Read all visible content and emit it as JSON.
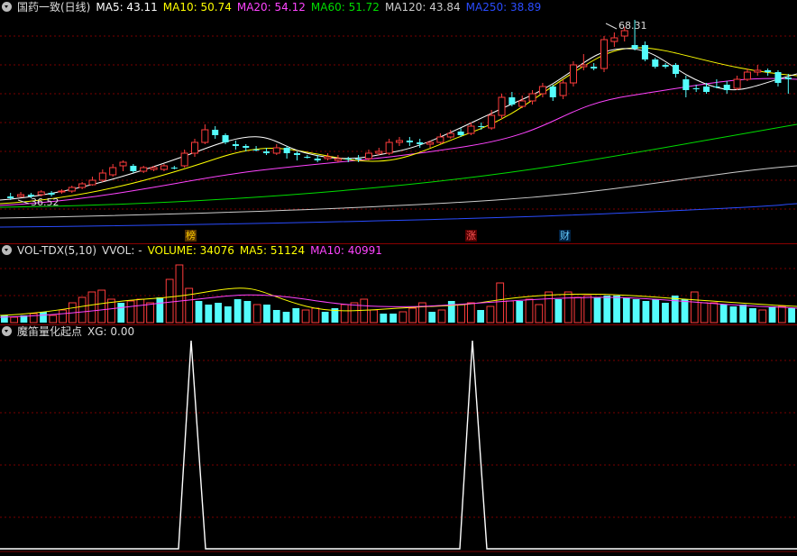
{
  "price_panel": {
    "title": "国药一致(日线)",
    "ma_labels": [
      {
        "text": "MA5: 43.11",
        "color": "#ffffff"
      },
      {
        "text": "MA10: 50.74",
        "color": "#ffff00"
      },
      {
        "text": "MA20: 54.12",
        "color": "#ff44ff"
      },
      {
        "text": "MA60: 51.72",
        "color": "#00dd00"
      },
      {
        "text": "MA120: 43.84",
        "color": "#cccccc"
      },
      {
        "text": "MA250: 38.89",
        "color": "#2a4cff"
      }
    ],
    "high_label": "68.31",
    "low_label": "36.52",
    "markers": [
      {
        "text": "榜",
        "color": "#ffcc00",
        "bg": "#553300"
      },
      {
        "text": "涨",
        "color": "#ff5555",
        "bg": "#550000"
      },
      {
        "text": "财",
        "color": "#66ccff",
        "bg": "#002244"
      }
    ]
  },
  "volume_panel": {
    "title": "VOL-TDX(5,10)",
    "labels": [
      {
        "text": "VVOL: -",
        "color": "#dddddd"
      },
      {
        "text": "VOLUME: 34076",
        "color": "#ffff00"
      },
      {
        "text": "MA5: 51124",
        "color": "#ffff00"
      },
      {
        "text": "MA10: 40991",
        "color": "#ff44ff"
      }
    ]
  },
  "indicator_panel": {
    "title": "魔笛量化起点",
    "labels": [
      {
        "text": "XG: 0.00",
        "color": "#dddddd"
      }
    ]
  },
  "colors": {
    "up": "#ff3c3c",
    "down": "#54fcfc",
    "grid": "#7a0000",
    "ma5": "#ffffff",
    "ma10": "#ffff00",
    "ma20": "#ff44ff",
    "ma60": "#00dd00",
    "ma120": "#cccccc",
    "ma250": "#2a4cff"
  }
}
